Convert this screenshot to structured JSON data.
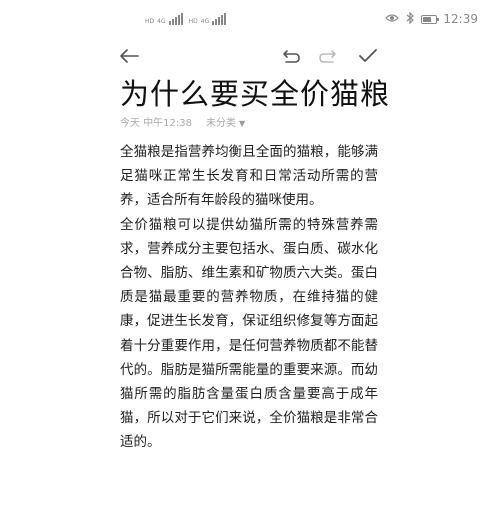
{
  "status_bar": {
    "signal_tag_1": "HD",
    "signal_tag_2": "HD",
    "network_1": "4G",
    "network_2": "4G",
    "time": "12:39",
    "icons": [
      "eye-icon",
      "bluetooth-icon",
      "battery-icon"
    ],
    "battery_level": 0.65
  },
  "toolbar": {
    "back_icon": "back-arrow-icon",
    "undo_icon": "undo-icon",
    "redo_icon": "redo-icon",
    "done_icon": "check-icon"
  },
  "note": {
    "title": "为什么要买全价猫粮",
    "date": "今天 中午12:38",
    "category": "未分类",
    "paragraphs": [
      "全猫粮是指营养均衡且全面的猫粮，能够满足猫咪正常生长发育和日常活动所需的营养，适合所有年龄段的猫咪使用。",
      "全价猫粮可以提供幼猫所需的特殊营养需求，营养成分主要包括水、蛋白质、碳水化合物、脂肪、维生素和矿物质六大类。蛋白质是猫最重要的营养物质，在维持猫的健康，促进生长发育，保证组织修复等方面起着十分重要作用，是任何营养物质都不能替代的。脂肪是猫所需能量的重要来源。而幼猫所需的脂肪含量蛋白质含量要高于成年猫，所以对于它们来说，全价猫粮是非常合适的。"
    ]
  },
  "colors": {
    "text": "#222222",
    "meta": "#aaaaaa",
    "icon": "#555555",
    "disabled_icon": "#bbbbbb"
  }
}
